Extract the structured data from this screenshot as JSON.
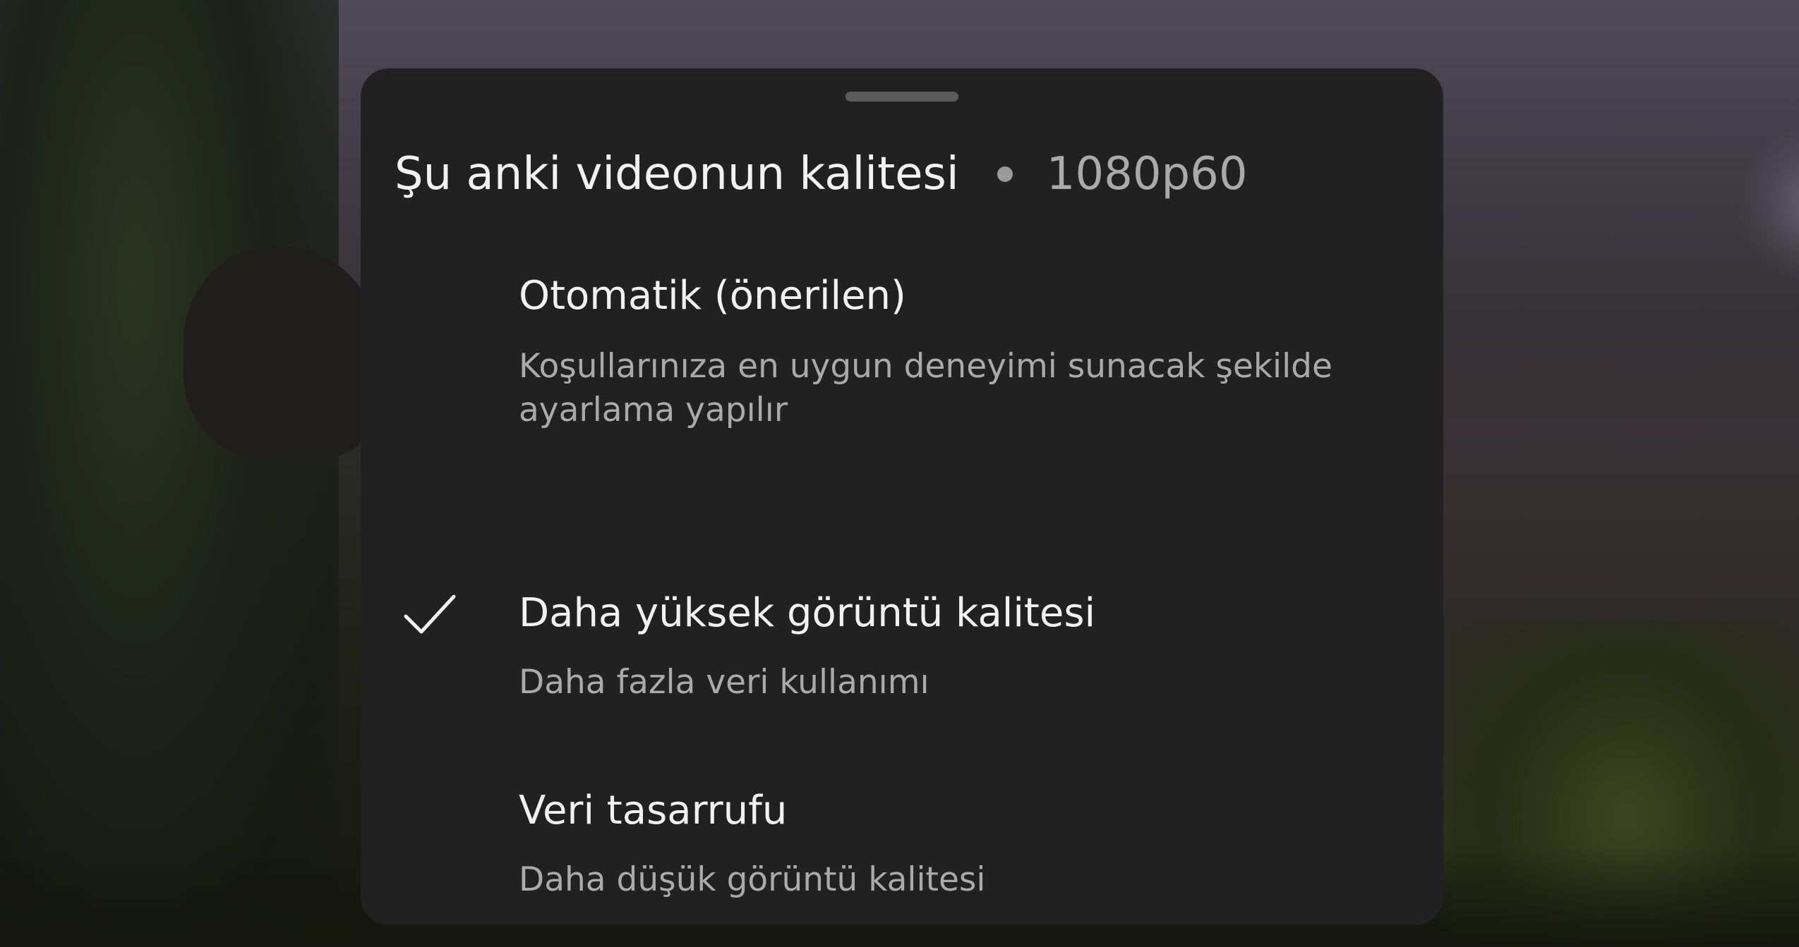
{
  "sheet": {
    "title": "Şu anki videonun kalitesi",
    "current_quality": "1080p60"
  },
  "options": [
    {
      "label": "Otomatik (önerilen)",
      "description": "Koşullarınıza en uygun deneyimi sunacak şekilde ayarlama yapılır",
      "selected": false
    },
    {
      "label": "Daha yüksek görüntü kalitesi",
      "description": "Daha fazla veri kullanımı",
      "selected": true
    },
    {
      "label": "Veri tasarrufu",
      "description": "Daha düşük görüntü kalitesi",
      "selected": false
    }
  ],
  "icons": {
    "selected": "checkmark-icon"
  },
  "colors": {
    "sheet_background": "#212121",
    "primary_text": "#f1f1f1",
    "secondary_text": "#aaaaaa"
  }
}
